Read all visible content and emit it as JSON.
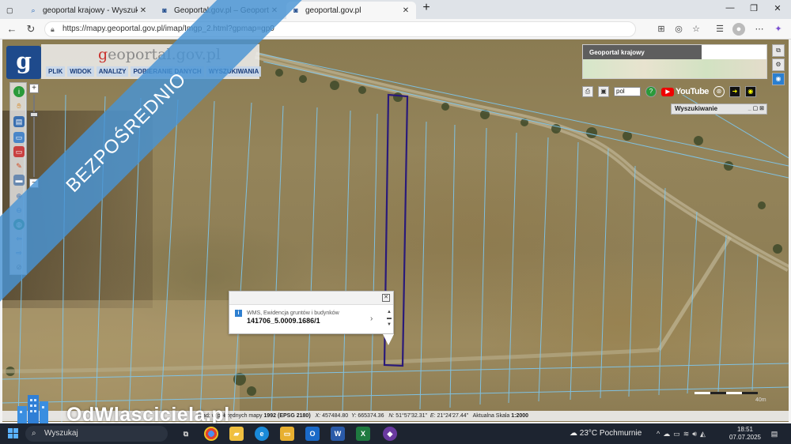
{
  "browser": {
    "tabs": [
      {
        "title": "geoportal krajowy - Wyszukaj",
        "active": false,
        "icon": "search-icon"
      },
      {
        "title": "Geoportal.gov.pl – Geoportal Inf",
        "active": false,
        "icon": "geoportal-icon"
      },
      {
        "title": "geoportal.gov.pl",
        "active": true,
        "icon": "geoportal-icon"
      }
    ],
    "url": "https://mapy.geoportal.gov.pl/imap/Imgp_2.html?gpmap=gp0"
  },
  "geoportal": {
    "logo_letter": "g",
    "title_g": "g",
    "title_rest": "eoportal.gov.pl",
    "menu": [
      "PLIK",
      "WIDOK",
      "ANALIZY",
      "POBIERANIE DANYCH",
      "WYSZUKIWANIA"
    ],
    "overview_title": "Geoportal krajowy",
    "language": "pol",
    "youtube_label": "YouTube",
    "search_title": "Wyszukiwanie",
    "search_ctrls": "_ ▢ ⊠"
  },
  "popup": {
    "layer": "WMS, Ewidencja gruntów i budynków",
    "parcel_id": "141706_5.0009.1686/1"
  },
  "status": {
    "prefix": "kład: w półrzędnych mapy",
    "crs": "1992 (EPSG 2180)",
    "x_label": "X:",
    "x_val": "457484.80",
    "y_label": "Y:",
    "y_val": "665374.36",
    "n_label": "N:",
    "n_val": "51°57'32.31\"",
    "e_label": "E:",
    "e_val": "21°24'27.44\"",
    "scale_label": "Aktualna Skala",
    "scale_val": "1:2000"
  },
  "scale_text": "40m",
  "watermark": {
    "ribbon": "BEZPOŚREDNIO",
    "brand": "OdWlasciciela.pl"
  },
  "taskbar": {
    "search_placeholder": "Wyszukaj",
    "weather_temp": "23°C",
    "weather_desc": "Pochmurnie",
    "time": "18:51",
    "date": "07.07.2025"
  },
  "colors": {
    "ribbon": "#4894d4",
    "parcel_outline": "#2a1a7a",
    "cadastral_lines": "#7ec8f0",
    "taskbar": "#1d2430"
  }
}
